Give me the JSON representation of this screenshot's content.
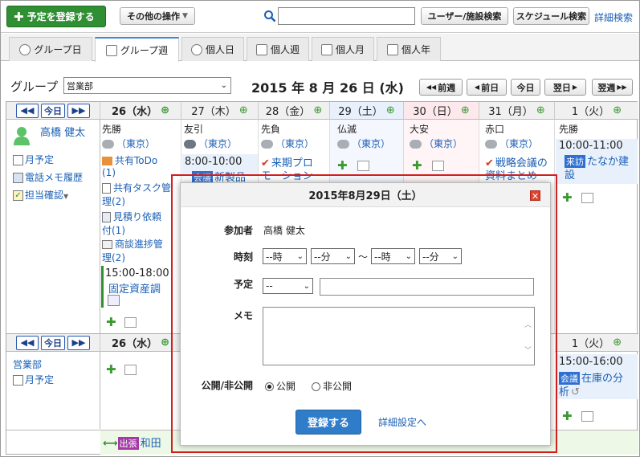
{
  "topbar": {
    "register_label": "予定を登録する",
    "other_ops_label": "その他の操作",
    "search_value": "",
    "user_search_label": "ユーザー/施設検索",
    "schedule_search_label": "スケジュール検索",
    "detail_search_label": "詳細検索"
  },
  "tabs": [
    "グループ日",
    "グループ週",
    "個人日",
    "個人週",
    "個人月",
    "個人年"
  ],
  "group": {
    "label": "グループ",
    "selected": "営業部",
    "date_title": "2015 年 8 月 26 日 (水)",
    "prev_week": "前週",
    "prev_day": "前日",
    "today": "今日",
    "next_day": "翌日",
    "next_week": "翌週"
  },
  "grid": {
    "today_btn": "今日",
    "days": [
      {
        "label": "26（水）",
        "rokuyo": "先勝"
      },
      {
        "label": "27（木）",
        "rokuyo": "友引"
      },
      {
        "label": "28（金）",
        "rokuyo": "先負"
      },
      {
        "label": "29（土）",
        "rokuyo": "仏滅"
      },
      {
        "label": "30（日）",
        "rokuyo": "大安"
      },
      {
        "label": "31（月）",
        "rokuyo": "赤口"
      },
      {
        "label": "1（火）",
        "rokuyo": "先勝"
      }
    ],
    "weather": "（東京）",
    "user": {
      "name": "高橋 健太",
      "link1": "月予定",
      "link2": "電話メモ履歴",
      "link3": "担当確認"
    },
    "items_26": {
      "todo": "共有ToDo",
      "todo_count": "(1)",
      "task": "共有タスク管",
      "task_count": "理(2)",
      "estimate": "見積り依頼",
      "estimate_count": "付(1)",
      "deal": "商談進捗管",
      "deal_count": "理(2)",
      "event_time": "15:00-18:00",
      "event_title": "固定資産調"
    },
    "items_27": {
      "time": "8:00-10:00",
      "badge": "会議",
      "title": "新製品"
    },
    "items_28": {
      "title": "来期プロ",
      "title2": "モーション"
    },
    "items_31": {
      "title": "戦略会議の",
      "title2": "資料まとめ"
    },
    "items_1": {
      "time": "10:00-11:00",
      "badge": "来訪",
      "title": "たなか建",
      "title2": "設"
    },
    "group_row": {
      "name": "営業部",
      "link": "月予定",
      "day1": "26（水）",
      "day_last": "1（火）",
      "last_time": "15:00-16:00",
      "last_badge": "会議",
      "last_title": "在庫の分",
      "last_title2": "析"
    },
    "trip": {
      "badge": "出張",
      "name": "和田"
    }
  },
  "dialog": {
    "title": "2015年8月29日（土）",
    "participant_label": "参加者",
    "participant_value": "高橋 健太",
    "time_label": "時刻",
    "hour_placeholder": "--時",
    "minute_placeholder": "--分",
    "range_sep": "〜",
    "plan_label": "予定",
    "plan_select": "--",
    "plan_text": "",
    "memo_label": "メモ",
    "memo_value": "",
    "visibility_label": "公開/非公開",
    "public_label": "公開",
    "private_label": "非公開",
    "submit_label": "登録する",
    "detail_link": "詳細設定へ"
  },
  "colors": {
    "accent_green": "#2f8f32",
    "primary_blue": "#2f7cc9",
    "highlight_red": "#d21f1f"
  }
}
